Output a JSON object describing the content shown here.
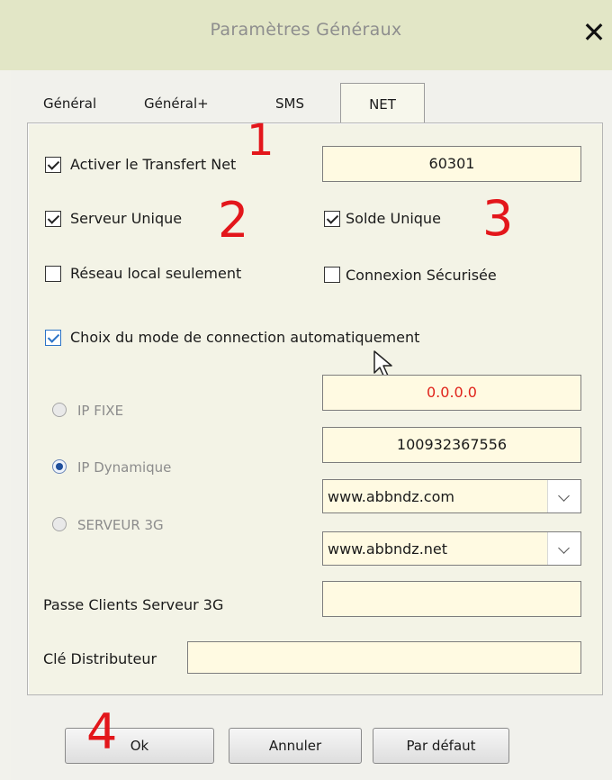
{
  "window": {
    "title": "Paramètres Généraux",
    "close_glyph": "✕"
  },
  "tabs": [
    {
      "label": "Général",
      "active": false
    },
    {
      "label": "Général+",
      "active": false
    },
    {
      "label": "SMS",
      "active": false
    },
    {
      "label": "NET",
      "active": true
    }
  ],
  "net": {
    "activer_transfert": {
      "label": "Activer le Transfert Net",
      "checked": true
    },
    "port_value": "60301",
    "serveur_unique": {
      "label": "Serveur Unique",
      "checked": true
    },
    "solde_unique": {
      "label": "Solde Unique",
      "checked": true
    },
    "reseau_local": {
      "label": "Réseau local seulement",
      "checked": false
    },
    "connexion_securisee": {
      "label": "Connexion Sécurisée",
      "checked": false
    },
    "choix_mode": {
      "label": "Choix du mode de connection automatiquement",
      "checked": true
    },
    "ip_fixe": {
      "label": "IP FIXE",
      "selected": false,
      "value": "0.0.0.0",
      "value_color": "#e0241c"
    },
    "ip_dynamique": {
      "label": "IP Dynamique",
      "selected": true,
      "value": "100932367556"
    },
    "serveur_3g": {
      "label": "SERVEUR 3G",
      "selected": false
    },
    "combo1": {
      "value": "www.abbndz.com"
    },
    "combo2": {
      "value": "www.abbndz.net"
    },
    "passe_clients": {
      "label": "Passe Clients Serveur 3G",
      "value": ""
    },
    "cle_distributeur": {
      "label": "Clé Distributeur",
      "value": ""
    }
  },
  "buttons": {
    "ok": "Ok",
    "annuler": "Annuler",
    "par_defaut": "Par défaut"
  },
  "annotations": {
    "one": "1",
    "two": "2",
    "three": "3",
    "four": "4"
  },
  "colors": {
    "titlebar": "#e2e6c6",
    "field_bg": "#fffae2",
    "annotation_red": "#e3161b",
    "checkbox_blue": "#2b73c7"
  }
}
